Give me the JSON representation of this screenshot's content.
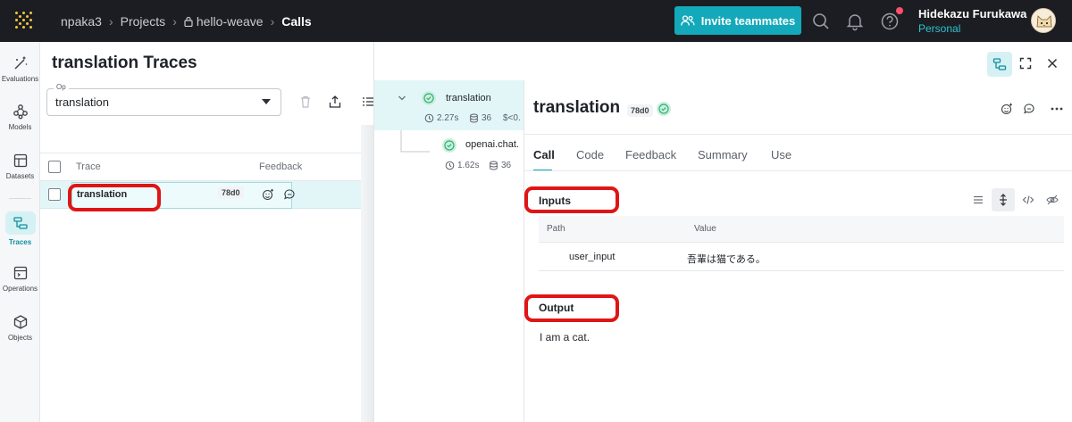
{
  "header": {
    "breadcrumbs": [
      "npaka3",
      "Projects",
      "hello-weave",
      "Calls"
    ],
    "invite_label": "Invite teammates",
    "user_name": "Hidekazu Furukawa",
    "user_org": "Personal"
  },
  "nav": {
    "items": [
      {
        "label": "Evaluations",
        "icon": "wand-icon"
      },
      {
        "label": "Models",
        "icon": "models-icon"
      },
      {
        "label": "Datasets",
        "icon": "datasets-icon"
      },
      {
        "label": "Traces",
        "icon": "traces-icon",
        "active": true
      },
      {
        "label": "Operations",
        "icon": "operations-icon"
      },
      {
        "label": "Objects",
        "icon": "cube-icon"
      }
    ]
  },
  "page": {
    "title": "translation Traces",
    "op_label": "Op",
    "op_value": "translation",
    "columns": [
      "Trace",
      "Feedback"
    ],
    "rows": [
      {
        "trace": "translation",
        "id": "78d0"
      }
    ]
  },
  "tree": {
    "root": {
      "label": "translation",
      "duration": "2.27s",
      "tokens": "36",
      "cost": "$<0."
    },
    "child": {
      "label": "openai.chat.",
      "duration": "1.62s",
      "tokens": "36"
    }
  },
  "detail": {
    "title": "translation",
    "id": "78d0",
    "tabs": [
      "Call",
      "Code",
      "Feedback",
      "Summary",
      "Use"
    ],
    "active_tab": "Call",
    "inputs_label": "Inputs",
    "inputs_columns": [
      "Path",
      "Value"
    ],
    "inputs_rows": [
      {
        "path": "user_input",
        "value": "吾輩は猫である。"
      }
    ],
    "output_label": "Output",
    "output_value": "I am a cat."
  },
  "colors": {
    "accent": "#13a9ba",
    "topbar": "#1b1d22",
    "highlight": "#e01515",
    "selected_row": "#e2f6f8",
    "status_ok": "#2fb36f"
  }
}
